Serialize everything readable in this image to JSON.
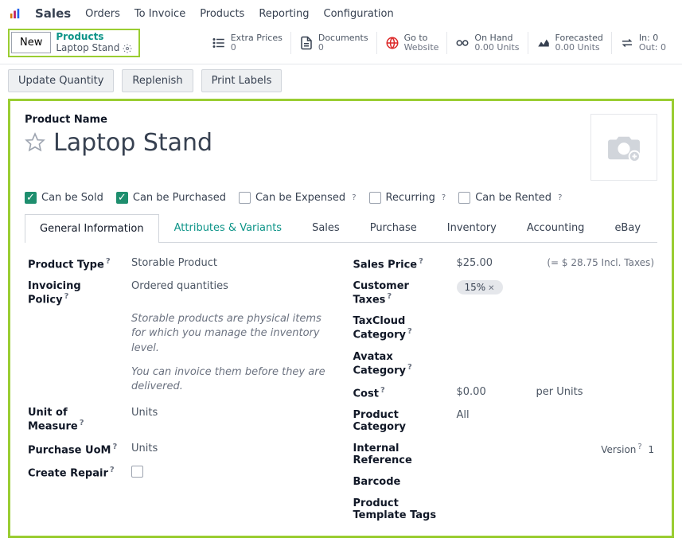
{
  "nav": {
    "brand": "Sales",
    "links": [
      "Orders",
      "To Invoice",
      "Products",
      "Reporting",
      "Configuration"
    ]
  },
  "breadcrumb": {
    "new_btn": "New",
    "parent": "Products",
    "current": "Laptop Stand"
  },
  "stats": [
    {
      "icon": "list",
      "label": "Extra Prices",
      "value": "0"
    },
    {
      "icon": "doc",
      "label": "Documents",
      "value": "0"
    },
    {
      "icon": "globe",
      "label": "Go to",
      "value": "Website"
    },
    {
      "icon": "link",
      "label": "On Hand",
      "value": "0.00 Units"
    },
    {
      "icon": "chart",
      "label": "Forecasted",
      "value": "0.00 Units"
    },
    {
      "icon": "swap",
      "label": "In: 0",
      "value": "Out: 0"
    }
  ],
  "actions": {
    "update_qty": "Update Quantity",
    "replenish": "Replenish",
    "print_labels": "Print Labels"
  },
  "form": {
    "product_name_label": "Product Name",
    "product_name": "Laptop Stand",
    "checkboxes": [
      {
        "label": "Can be Sold",
        "checked": true,
        "q": false
      },
      {
        "label": "Can be Purchased",
        "checked": true,
        "q": false
      },
      {
        "label": "Can be Expensed",
        "checked": false,
        "q": true
      },
      {
        "label": "Recurring",
        "checked": false,
        "q": true
      },
      {
        "label": "Can be Rented",
        "checked": false,
        "q": true
      }
    ],
    "tabs": [
      "General Information",
      "Attributes & Variants",
      "Sales",
      "Purchase",
      "Inventory",
      "Accounting",
      "eBay"
    ],
    "left": {
      "product_type": {
        "label": "Product Type",
        "q": true,
        "value": "Storable Product"
      },
      "invoicing_policy": {
        "label": "Invoicing Policy",
        "q": true,
        "value": "Ordered quantities"
      },
      "hint1": "Storable products are physical items for which you manage the inventory level.",
      "hint2": "You can invoice them before they are delivered.",
      "uom": {
        "label": "Unit of Measure",
        "q": true,
        "value": "Units"
      },
      "purchase_uom": {
        "label": "Purchase UoM",
        "q": true,
        "value": "Units"
      },
      "create_repair": {
        "label": "Create Repair",
        "q": true,
        "checked": false
      }
    },
    "right": {
      "sales_price": {
        "label": "Sales Price",
        "q": true,
        "value": "$25.00",
        "incl": "(= $ 28.75 Incl. Taxes)"
      },
      "customer_taxes": {
        "label": "Customer Taxes",
        "q": true,
        "tag": "15%"
      },
      "taxcloud": {
        "label": "TaxCloud Category",
        "q": true
      },
      "avatax": {
        "label": "Avatax Category",
        "q": true
      },
      "cost": {
        "label": "Cost",
        "q": true,
        "value": "$0.00",
        "per": "per Units"
      },
      "product_category": {
        "label": "Product Category",
        "value": "All"
      },
      "internal_ref": {
        "label": "Internal Reference",
        "version_label": "Version",
        "version": "1"
      },
      "barcode": {
        "label": "Barcode"
      },
      "tags": {
        "label": "Product Template Tags"
      }
    }
  }
}
